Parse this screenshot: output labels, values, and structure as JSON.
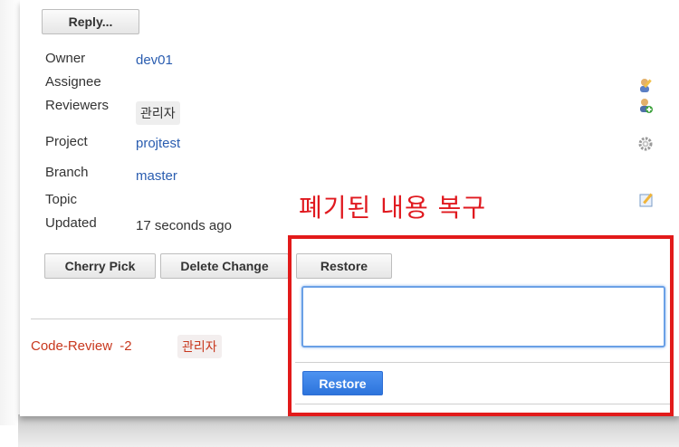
{
  "toolbar": {
    "reply_label": "Reply..."
  },
  "info": {
    "owner": {
      "label": "Owner",
      "value": "dev01"
    },
    "assignee": {
      "label": "Assignee",
      "value": ""
    },
    "reviewers": {
      "label": "Reviewers",
      "value": "관리자"
    },
    "project": {
      "label": "Project",
      "value": "projtest"
    },
    "branch": {
      "label": "Branch",
      "value": "master"
    },
    "topic": {
      "label": "Topic",
      "value": ""
    },
    "updated": {
      "label": "Updated",
      "value": "17 seconds ago"
    }
  },
  "actions": {
    "cherry_pick": "Cherry Pick",
    "delete_change": "Delete Change",
    "restore": "Restore"
  },
  "annotation": "폐기된 내용 복구",
  "restore_dialog": {
    "textarea_value": "",
    "submit_label": "Restore"
  },
  "review": {
    "label": "Code-Review",
    "score": "-2",
    "reviewer": "관리자"
  },
  "colors": {
    "link": "#2a5db0",
    "annotation_red": "#e0191f",
    "primary_blue": "#2d74dc",
    "review_red": "#c8381e"
  },
  "icons": [
    "assignee-edit-icon",
    "add-reviewer-icon",
    "project-settings-gear-icon",
    "topic-edit-icon"
  ]
}
